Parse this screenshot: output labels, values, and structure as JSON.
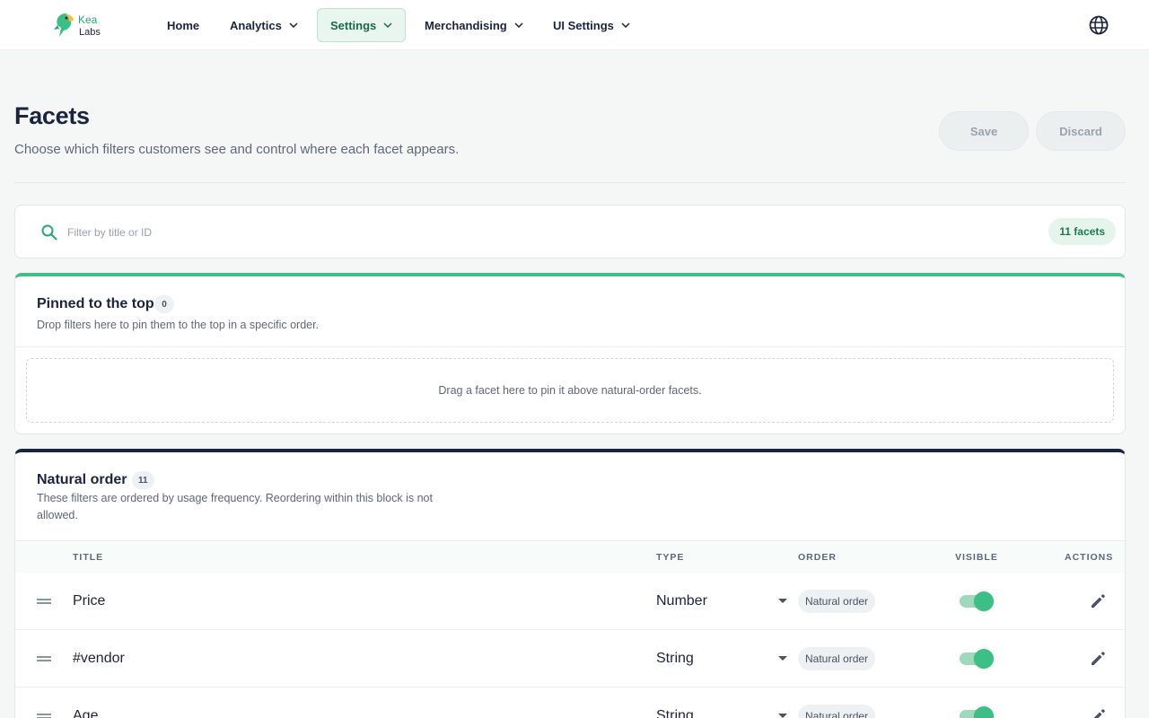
{
  "brand": {
    "name_line1": "Kea",
    "name_line2": "Labs"
  },
  "nav": {
    "items": [
      {
        "label": "Home",
        "has_menu": false
      },
      {
        "label": "Analytics",
        "has_menu": true
      },
      {
        "label": "Settings",
        "has_menu": true,
        "active": true
      },
      {
        "label": "Merchandising",
        "has_menu": true
      },
      {
        "label": "UI Settings",
        "has_menu": true
      }
    ],
    "language_icon": "globe-icon"
  },
  "header": {
    "title": "Facets",
    "subtitle": "Choose which filters customers see and control where each facet appears.",
    "save_label": "Save",
    "discard_label": "Discard"
  },
  "filter": {
    "placeholder": "Filter by title or ID",
    "value": "",
    "count_label": "11 facets"
  },
  "pinned": {
    "title": "Pinned to the top",
    "count": "0",
    "description": "Drop filters here to pin them to the top in a specific order.",
    "dropzone_text": "Drag a facet here to pin it above natural-order facets."
  },
  "natural": {
    "title": "Natural order",
    "count": "11",
    "description_line1": "These filters are ordered by usage frequency. Reordering within this block is not",
    "description_line2": "allowed.",
    "columns": {
      "title": "TITLE",
      "type": "TYPE",
      "order": "ORDER",
      "visible": "VISIBLE",
      "actions": "ACTIONS"
    },
    "rows": [
      {
        "title": "Price",
        "type": "Number",
        "order": "Natural order",
        "visible": true
      },
      {
        "title": "#vendor",
        "type": "String",
        "order": "Natural order",
        "visible": true
      },
      {
        "title": "Age",
        "type": "String",
        "order": "Natural order",
        "visible": true
      }
    ]
  },
  "colors": {
    "accent": "#3cbf84",
    "navy": "#1c2340",
    "active_nav_bg": "#e8f6ef"
  }
}
